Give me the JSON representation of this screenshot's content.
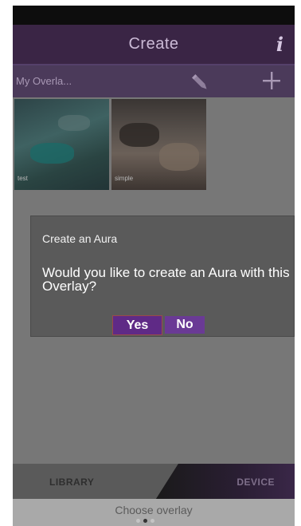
{
  "header": {
    "title": "Create",
    "info_icon": "i"
  },
  "toolbar": {
    "overlay_label": "My Overla...",
    "edit_icon": "pencil-icon",
    "add_icon": "plus-icon"
  },
  "library": {
    "items": [
      {
        "label": "test"
      },
      {
        "label": "simple"
      }
    ]
  },
  "dialog": {
    "title": "Create an Aura",
    "message": "Would you like to create an Aura with this Overlay?",
    "yes_label": "Yes",
    "no_label": "No"
  },
  "tabs": {
    "library_label": "LIBRARY",
    "device_label": "DEVICE",
    "active": "LIBRARY"
  },
  "footer": {
    "label": "Choose overlay",
    "page_dots": 3,
    "active_dot": 1
  },
  "colors": {
    "title_bar": "#3a2545",
    "toolbar": "#4b3a5a",
    "dialog_bg": "#5a5a5a",
    "button_purple": "#6a3a95"
  }
}
